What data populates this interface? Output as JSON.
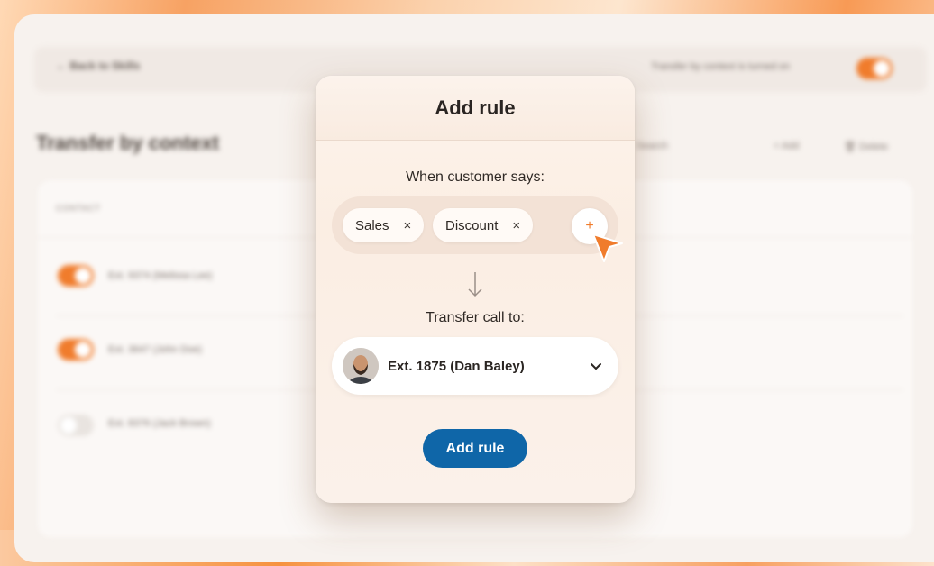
{
  "background": {
    "back_link": "Back to Skills",
    "top_toggle_label": "Transfer by context is turned on",
    "page_heading": "Transfer by context",
    "search_placeholder": "Search",
    "add_label": "+ Add",
    "delete_label": "Delete",
    "column_header": "CONTACT",
    "rows": [
      {
        "label": "Ext. 9374 (Melissa Lee)",
        "enabled": true
      },
      {
        "label": "Ext. 3647 (John Doe)",
        "enabled": true
      },
      {
        "label": "Ext. 8376 (Jack Brown)",
        "enabled": false
      }
    ]
  },
  "modal": {
    "title": "Add rule",
    "when_label": "When customer says:",
    "chips": [
      "Sales",
      "Discount"
    ],
    "chip_remove_glyph": "×",
    "add_chip_glyph": "+",
    "transfer_label": "Transfer call to:",
    "selected_contact": "Ext. 1875 (Dan Baley)",
    "submit_label": "Add rule"
  },
  "colors": {
    "accent": "#f07c2c",
    "primary": "#0f66a8"
  },
  "icons": {
    "remove": "close-icon",
    "add": "plus-icon",
    "arrow": "arrow-down-icon",
    "dropdown": "chevron-down-icon",
    "cursor": "pointer-cursor-icon"
  }
}
